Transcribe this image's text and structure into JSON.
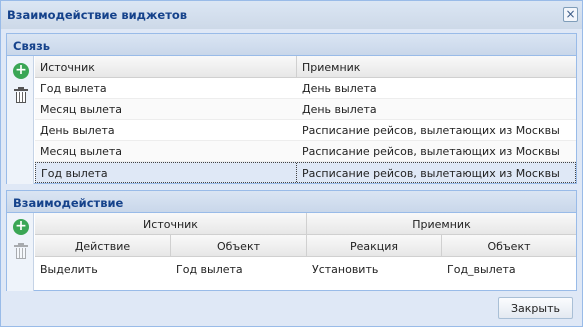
{
  "dialog": {
    "title": "Взаимодействие виджетов",
    "close_glyph": "×"
  },
  "link_panel": {
    "title": "Связь",
    "columns": [
      "Источник",
      "Приемник"
    ],
    "rows": [
      {
        "source": "Год вылета",
        "target": "День вылета"
      },
      {
        "source": "Месяц вылета",
        "target": "День вылета"
      },
      {
        "source": "День вылета",
        "target": "Расписание рейсов, вылетающих из Москвы"
      },
      {
        "source": "Месяц вылета",
        "target": "Расписание рейсов, вылетающих из Москвы"
      },
      {
        "source": "Год вылета",
        "target": "Расписание рейсов, вылетающих из Москвы"
      }
    ],
    "selected_row": 4
  },
  "interaction_panel": {
    "title": "Взаимодействие",
    "group_headers": [
      "Источник",
      "Приемник"
    ],
    "columns": [
      "Действие",
      "Объект",
      "Реакция",
      "Объект"
    ],
    "rows": [
      {
        "action": "Выделить",
        "source_object": "Год вылета",
        "reaction": "Установить",
        "target_object": "Год_вылета"
      }
    ]
  },
  "footer": {
    "close_label": "Закрыть"
  },
  "icons": {
    "add": "plus-circle-icon",
    "delete": "trash-icon"
  }
}
